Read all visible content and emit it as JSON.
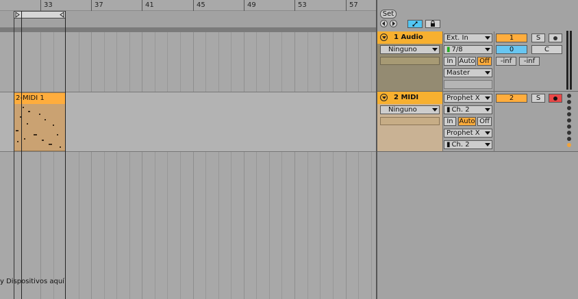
{
  "ruler": {
    "ticks": [
      "33",
      "37",
      "41",
      "45",
      "49",
      "53",
      "57"
    ]
  },
  "tracks": [
    {
      "name": "1 Audio",
      "color": "#e9b14a",
      "input_type": "Ninguno",
      "input_channel": "Ext. In",
      "channel_sel": "7/8",
      "monitor": [
        "In",
        "Auto",
        "Off"
      ],
      "monitor_active": "Off",
      "output": "Master",
      "number": "1",
      "solo": "S",
      "volume": "0",
      "pan": "C",
      "peak_left": "-inf",
      "peak_right": "-inf"
    },
    {
      "name": "2 MIDI",
      "color": "#e9b14a",
      "input_type": "Ninguno",
      "input_channel": "Prophet X",
      "channel_sel": "Ch. 2",
      "monitor": [
        "In",
        "Auto",
        "Off"
      ],
      "monitor_active": "Auto",
      "output": "Prophet X",
      "output_channel": "Ch. 2",
      "number": "2",
      "solo": "S",
      "clip_name": "2-MIDI 1"
    }
  ],
  "mixer": {
    "set_label": "Set"
  },
  "hint_text": "y Dispositivos aquí"
}
